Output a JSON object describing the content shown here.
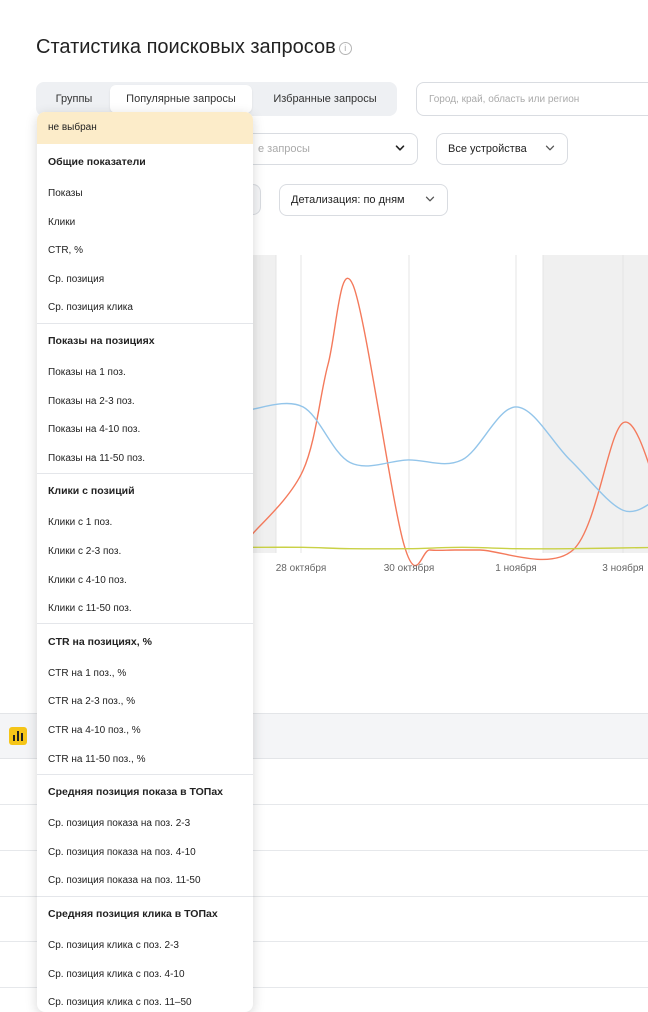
{
  "page": {
    "title": "Статистика поисковых запросов",
    "info_icon": "info-circle-icon"
  },
  "tabs": [
    {
      "label": "Группы",
      "active": false
    },
    {
      "label": "Популярные запросы",
      "active": true
    },
    {
      "label": "Избранные запросы",
      "active": false
    }
  ],
  "region": {
    "placeholder": "Город, край, область или регион"
  },
  "filters": {
    "queries_select": "е запросы",
    "devices_select": "Все устройства",
    "detail_select": "Детализация: по дням"
  },
  "chart_data": {
    "type": "line",
    "x_ticks": [
      "28 октября",
      "30 октября",
      "1 ноября",
      "3 ноября"
    ],
    "weekend_shading": true,
    "series": [
      {
        "color": "#f47a5c",
        "values": [
          0.05,
          0.3,
          0.7,
          1.0,
          0.02,
          0.0,
          0.0,
          0.0,
          0.0,
          0.48,
          0.2
        ]
      },
      {
        "color": "#93c5ea",
        "values": [
          0.53,
          0.54,
          0.33,
          0.34,
          0.34,
          0.54,
          0.34,
          0.15,
          0.2
        ]
      },
      {
        "color": "#c9d146",
        "values": [
          0.01,
          0.01,
          0.005,
          0.005,
          0.01,
          0.005,
          0.005,
          0.01
        ]
      }
    ],
    "colors": {
      "weekend": "#f0f0f0",
      "grid": "#e4e4e4"
    }
  },
  "table": {
    "header_icon": "bar-chart-icon"
  },
  "dropdown": {
    "selected": "не выбран",
    "groups": [
      {
        "title": "Общие показатели",
        "items": [
          "Показы",
          "Клики",
          "CTR, %",
          "Ср. позиция",
          "Ср. позиция клика"
        ]
      },
      {
        "title": "Показы на позициях",
        "items": [
          "Показы на 1 поз.",
          "Показы на 2-3 поз.",
          "Показы на 4-10 поз.",
          "Показы на 11-50 поз."
        ]
      },
      {
        "title": "Клики с позиций",
        "items": [
          "Клики с 1 поз.",
          "Клики с 2-3 поз.",
          "Клики с 4-10 поз.",
          "Клики с 11-50 поз."
        ]
      },
      {
        "title": "CTR на позициях, %",
        "items": [
          "CTR на 1 поз., %",
          "CTR на 2-3 поз., %",
          "CTR на 4-10 поз., %",
          "CTR на 11-50 поз., %"
        ]
      },
      {
        "title": "Средняя позиция показа в ТОПах",
        "items": [
          "Ср. позиция показа на поз. 2-3",
          "Ср. позиция показа на поз. 4-10",
          "Ср. позиция показа на поз. 11-50"
        ]
      },
      {
        "title": "Средняя позиция клика в ТОПах",
        "items": [
          "Ср. позиция клика с поз. 2-3",
          "Ср. позиция клика с поз. 4-10",
          "Ср. позиция клика с поз. 11–50"
        ]
      }
    ]
  }
}
